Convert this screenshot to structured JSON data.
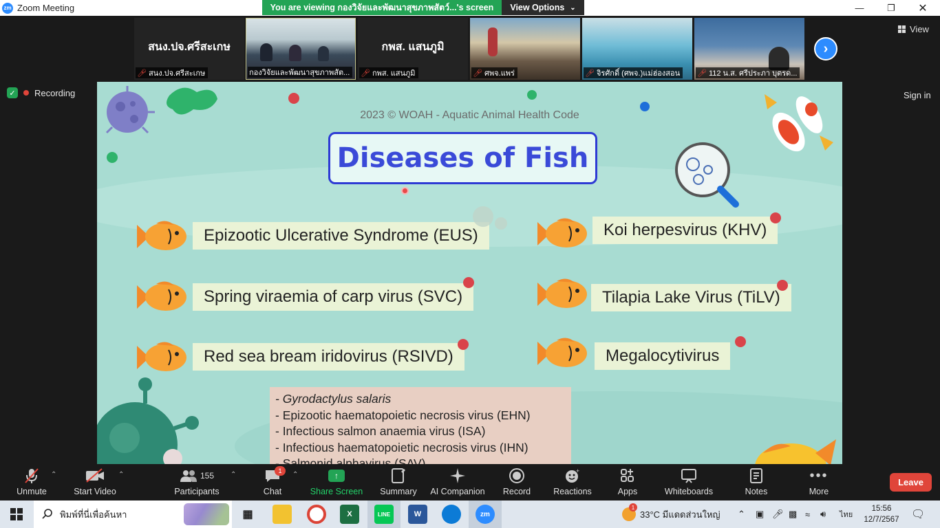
{
  "window": {
    "logo": "zm",
    "title": "Zoom Meeting"
  },
  "share_banner": {
    "text": "You are viewing กองวิจัยและพัฒนาสุขภาพสัตว์...'s screen",
    "options_label": "View Options"
  },
  "gallery": {
    "thumbnails": [
      {
        "big_name": "สนง.ปจ.ศรีสะเกษ",
        "label": "สนง.ปจ.ศรีสะเกษ"
      },
      {
        "big_name": "",
        "label": "กองวิจัยและพัฒนาสุขภาพสัต..."
      },
      {
        "big_name": "กพส. แสนภูมิ",
        "label": "กพส. แสนภูมิ"
      },
      {
        "big_name": "",
        "label": "ศพจ.แพร่"
      },
      {
        "big_name": "",
        "label": "จิรศักดิ์ (ศพจ.)แม่ฮ่องสอน"
      },
      {
        "big_name": "",
        "label": "112 น.ส. ศรีประภา บุตรด..."
      }
    ],
    "view_label": "View"
  },
  "status": {
    "recording_label": "Recording",
    "sign_in_label": "Sign in"
  },
  "slide": {
    "copyright": "2023 © WOAH - Aquatic Animal Health Code",
    "title": "Diseases of Fish",
    "left_diseases": [
      "Epizootic Ulcerative Syndrome (EUS)",
      "Spring viraemia of carp virus (SVC)",
      "Red sea bream iridovirus (RSIVD)"
    ],
    "right_diseases": [
      "Koi herpesvirus (KHV)",
      "Tilapia Lake Virus (TiLV)",
      "Megalocytivirus"
    ],
    "other_list": [
      "- Gyrodactylus salaris",
      "- Epizootic haematopoietic necrosis virus (EHN)",
      "- Infectious salmon anaemia virus (ISA)",
      "- Infectious haematopoietic necrosis virus (IHN)",
      "- Salmonid alphavirus (SAV)"
    ]
  },
  "toolbar": {
    "unmute": "Unmute",
    "start_video": "Start Video",
    "participants": "Participants",
    "participants_count": "155",
    "chat": "Chat",
    "chat_badge": "1",
    "share_screen": "Share Screen",
    "summary": "Summary",
    "ai_companion": "AI Companion",
    "record": "Record",
    "reactions": "Reactions",
    "apps": "Apps",
    "whiteboards": "Whiteboards",
    "notes": "Notes",
    "more": "More",
    "leave": "Leave"
  },
  "taskbar": {
    "search_placeholder": "พิมพ์ที่นี่เพื่อค้นหา",
    "weather_badge": "1",
    "weather": "33°C  มีแดดส่วนใหญ่",
    "language": "ไทย",
    "time": "15:56",
    "date": "12/7/2567",
    "zoom_label": "zm"
  },
  "colors": {
    "zoom_blue": "#2d8cff",
    "share_green": "#23a455",
    "leave_red": "#e0453a",
    "slide_bg": "#a8dcd2",
    "title_blue": "#3a4ad8"
  }
}
